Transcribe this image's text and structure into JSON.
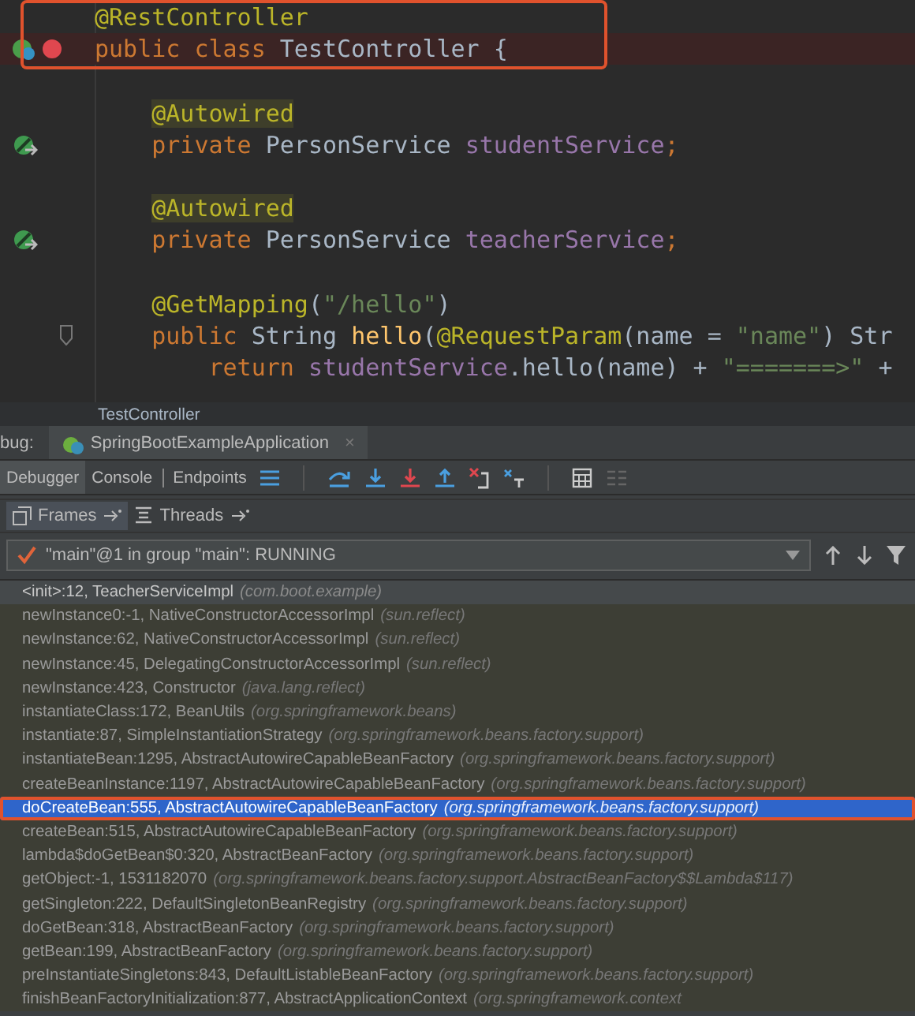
{
  "editor": {
    "boxed_lines": [
      {
        "kind": "plain",
        "tokens": [
          {
            "text": "@RestController",
            "kind": "annotation"
          }
        ]
      },
      {
        "kind": "breakpoint",
        "tokens": [
          {
            "text": "public class ",
            "kind": "keyword"
          },
          {
            "text": "TestController {",
            "kind": "plain"
          }
        ]
      }
    ],
    "lines": [
      {
        "kind": "blank"
      },
      {
        "kind": "plain",
        "tokens": [
          {
            "text": "    @Autowired",
            "kind": "marked"
          }
        ]
      },
      {
        "kind": "inject",
        "tokens": [
          {
            "text": "    private ",
            "kind": "keyword"
          },
          {
            "text": "PersonService ",
            "kind": "plain"
          },
          {
            "text": "studentService",
            "kind": "field"
          },
          {
            "text": ";",
            "kind": "keyword"
          }
        ]
      },
      {
        "kind": "blank"
      },
      {
        "kind": "plain",
        "tokens": [
          {
            "text": "    @Autowired",
            "kind": "marked"
          }
        ]
      },
      {
        "kind": "inject",
        "tokens": [
          {
            "text": "    private ",
            "kind": "keyword"
          },
          {
            "text": "PersonService ",
            "kind": "plain"
          },
          {
            "text": "teacherService",
            "kind": "field"
          },
          {
            "text": ";",
            "kind": "keyword"
          }
        ]
      },
      {
        "kind": "blank"
      },
      {
        "kind": "plain",
        "tokens": [
          {
            "text": "    @GetMapping",
            "kind": "annotation"
          },
          {
            "text": "(",
            "kind": "plain"
          },
          {
            "text": "\"/hello\"",
            "kind": "string"
          },
          {
            "text": ")",
            "kind": "plain"
          }
        ]
      },
      {
        "kind": "fold",
        "tokens": [
          {
            "text": "    public ",
            "kind": "keyword"
          },
          {
            "text": "String ",
            "kind": "plain"
          },
          {
            "text": "hello",
            "kind": "method"
          },
          {
            "text": "(",
            "kind": "plain"
          },
          {
            "text": "@RequestParam",
            "kind": "annotation"
          },
          {
            "text": "(name = ",
            "kind": "plain"
          },
          {
            "text": "\"name\"",
            "kind": "string"
          },
          {
            "text": ") Str",
            "kind": "plain"
          }
        ]
      },
      {
        "kind": "plain",
        "tokens": [
          {
            "text": "        return ",
            "kind": "keyword"
          },
          {
            "text": "studentService",
            "kind": "field"
          },
          {
            "text": ".hello(name) + ",
            "kind": "plain"
          },
          {
            "text": "\"=======>\"",
            "kind": "string"
          },
          {
            "text": " +",
            "kind": "plain"
          }
        ]
      }
    ],
    "breadcrumb": "TestController"
  },
  "debug": {
    "label": "bug:",
    "session_tab": {
      "name": "SpringBootExampleApplication",
      "close": "×"
    },
    "tabs": [
      {
        "label": "Debugger",
        "selected": true
      },
      {
        "label": "Console",
        "selected": false
      },
      {
        "label": "Endpoints",
        "selected": false
      }
    ],
    "view_tabs": [
      {
        "label": "Frames",
        "selected": true
      },
      {
        "label": "Threads",
        "selected": false
      }
    ],
    "thread": "\"main\"@1 in group \"main\": RUNNING",
    "frames": [
      {
        "method": "<init>:12, TeacherServiceImpl",
        "package": "(com.boot.example)",
        "current": true,
        "selected": false,
        "boxed": false
      },
      {
        "method": "newInstance0:-1, NativeConstructorAccessorImpl",
        "package": "(sun.reflect)",
        "current": false,
        "selected": false,
        "boxed": false
      },
      {
        "method": "newInstance:62, NativeConstructorAccessorImpl",
        "package": "(sun.reflect)",
        "current": false,
        "selected": false,
        "boxed": false
      },
      {
        "method": "newInstance:45, DelegatingConstructorAccessorImpl",
        "package": "(sun.reflect)",
        "current": false,
        "selected": false,
        "boxed": false
      },
      {
        "method": "newInstance:423, Constructor",
        "package": "(java.lang.reflect)",
        "current": false,
        "selected": false,
        "boxed": false
      },
      {
        "method": "instantiateClass:172, BeanUtils",
        "package": "(org.springframework.beans)",
        "current": false,
        "selected": false,
        "boxed": false
      },
      {
        "method": "instantiate:87, SimpleInstantiationStrategy",
        "package": "(org.springframework.beans.factory.support)",
        "current": false,
        "selected": false,
        "boxed": false
      },
      {
        "method": "instantiateBean:1295, AbstractAutowireCapableBeanFactory",
        "package": "(org.springframework.beans.factory.support)",
        "current": false,
        "selected": false,
        "boxed": false
      },
      {
        "method": "createBeanInstance:1197, AbstractAutowireCapableBeanFactory",
        "package": "(org.springframework.beans.factory.support)",
        "current": false,
        "selected": false,
        "boxed": false
      },
      {
        "method": "doCreateBean:555, AbstractAutowireCapableBeanFactory",
        "package": "(org.springframework.beans.factory.support)",
        "current": false,
        "selected": true,
        "boxed": true
      },
      {
        "method": "createBean:515, AbstractAutowireCapableBeanFactory",
        "package": "(org.springframework.beans.factory.support)",
        "current": false,
        "selected": false,
        "boxed": false
      },
      {
        "method": "lambda$doGetBean$0:320, AbstractBeanFactory",
        "package": "(org.springframework.beans.factory.support)",
        "current": false,
        "selected": false,
        "boxed": false
      },
      {
        "method": "getObject:-1, 1531182070",
        "package": "(org.springframework.beans.factory.support.AbstractBeanFactory$$Lambda$117)",
        "current": false,
        "selected": false,
        "boxed": false
      },
      {
        "method": "getSingleton:222, DefaultSingletonBeanRegistry",
        "package": "(org.springframework.beans.factory.support)",
        "current": false,
        "selected": false,
        "boxed": false
      },
      {
        "method": "doGetBean:318, AbstractBeanFactory",
        "package": "(org.springframework.beans.factory.support)",
        "current": false,
        "selected": false,
        "boxed": false
      },
      {
        "method": "getBean:199, AbstractBeanFactory",
        "package": "(org.springframework.beans.factory.support)",
        "current": false,
        "selected": false,
        "boxed": false
      },
      {
        "method": "preInstantiateSingletons:843, DefaultListableBeanFactory",
        "package": "(org.springframework.beans.factory.support)",
        "current": false,
        "selected": false,
        "boxed": false
      },
      {
        "method": "finishBeanFactoryInitialization:877, AbstractApplicationContext",
        "package": "(org.springframework.context",
        "current": false,
        "selected": false,
        "boxed": false
      }
    ]
  }
}
